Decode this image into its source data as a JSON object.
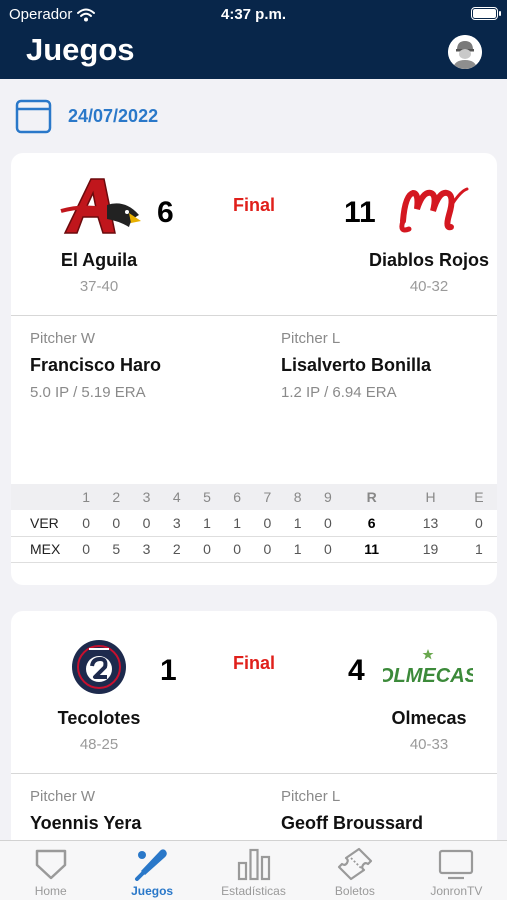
{
  "status_bar": {
    "carrier": "Operador",
    "time": "4:37 p.m."
  },
  "header": {
    "title": "Juegos"
  },
  "date": {
    "value": "24/07/2022"
  },
  "games": [
    {
      "status": "Final",
      "away": {
        "name": "El Aguila",
        "record": "37-40",
        "score": "6",
        "logo": "aguila-logo"
      },
      "home": {
        "name": "Diablos Rojos",
        "record": "40-32",
        "score": "11",
        "logo": "diablos-logo"
      },
      "pitcher_w": {
        "label": "Pitcher W",
        "name": "Francisco Haro",
        "stats": "5.0 IP / 5.19 ERA"
      },
      "pitcher_l": {
        "label": "Pitcher L",
        "name": "Lisalverto Bonilla",
        "stats": "1.2 IP / 6.94 ERA"
      },
      "linescore": {
        "headers": [
          "",
          "1",
          "2",
          "3",
          "4",
          "5",
          "6",
          "7",
          "8",
          "9",
          "R",
          "H",
          "E"
        ],
        "rows": [
          [
            "VER",
            "0",
            "0",
            "0",
            "3",
            "1",
            "1",
            "0",
            "1",
            "0",
            "6",
            "13",
            "0"
          ],
          [
            "MEX",
            "0",
            "5",
            "3",
            "2",
            "0",
            "0",
            "0",
            "1",
            "0",
            "11",
            "19",
            "1"
          ]
        ]
      }
    },
    {
      "status": "Final",
      "away": {
        "name": "Tecolotes",
        "record": "48-25",
        "score": "1",
        "logo": "tecolotes-logo"
      },
      "home": {
        "name": "Olmecas",
        "record": "40-33",
        "score": "4",
        "logo": "olmecas-logo",
        "logo_text": "OLMECAS"
      },
      "pitcher_w": {
        "label": "Pitcher W",
        "name": "Yoennis Yera"
      },
      "pitcher_l": {
        "label": "Pitcher L",
        "name": "Geoff Broussard"
      }
    }
  ],
  "tabbar": {
    "items": [
      {
        "label": "Home",
        "icon": "home-plate-icon",
        "active": false
      },
      {
        "label": "Juegos",
        "icon": "bat-ball-icon",
        "active": true
      },
      {
        "label": "Estadísticas",
        "icon": "bar-chart-icon",
        "active": false
      },
      {
        "label": "Boletos",
        "icon": "ticket-icon",
        "active": false
      },
      {
        "label": "JonronTV",
        "icon": "tv-icon",
        "active": false
      }
    ]
  },
  "colors": {
    "header_bg": "#08264a",
    "accent": "#2a78c9",
    "final": "#e0201b",
    "background": "#f2f2f6"
  }
}
